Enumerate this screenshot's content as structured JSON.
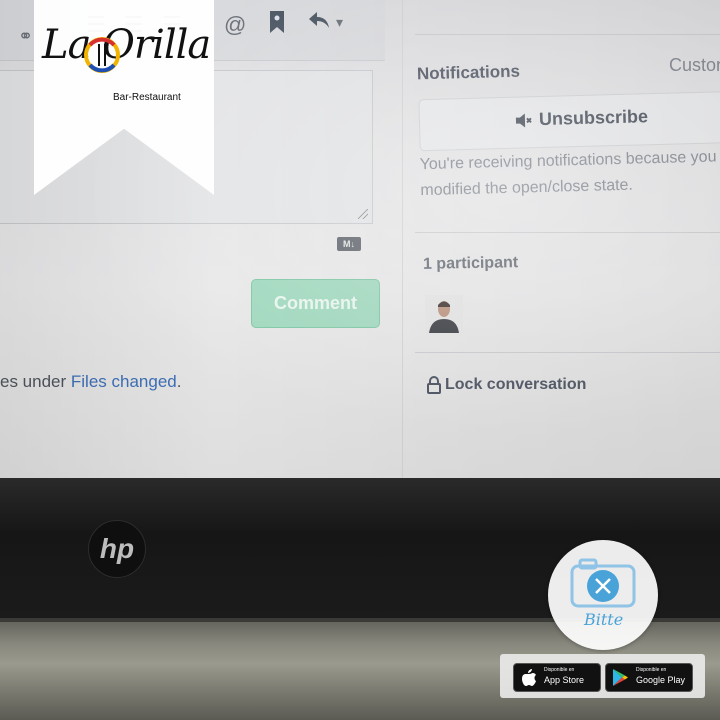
{
  "brand": {
    "name": "La Orilla",
    "subtitle": "Bar-Restaurant",
    "colors": {
      "banner": "#ffffff",
      "accent_blue": "#1f4fb0",
      "accent_yellow": "#f2b400",
      "accent_red": "#d6312c"
    }
  },
  "editor": {
    "markdown_badge": "M↓",
    "comment_button": "Comment",
    "footer_prefix": "es under ",
    "footer_link": "Files changed",
    "footer_suffix": "."
  },
  "toolbar": {
    "icons": [
      "link-icon",
      "unordered-list-icon",
      "ordered-list-icon",
      "task-list-icon",
      "mention-icon",
      "bookmark-icon",
      "reply-icon",
      "chevron-down-icon"
    ],
    "mention_glyph": "@",
    "dropdown_glyph": "▾"
  },
  "sidebar": {
    "notifications_label": "Notifications",
    "customize_label": "Custon",
    "unsubscribe_label": "Unsubscribe",
    "notification_reason": "You're receiving notifications because you modified the open/close state.",
    "participants_label": "1 participant",
    "lock_label": "Lock conversation"
  },
  "device": {
    "brand_logo": "hp"
  },
  "app_badge": {
    "name": "Bitte",
    "stores": [
      {
        "small": "Disponible en",
        "big": "App Store",
        "icon": "apple-icon"
      },
      {
        "small": "Disponible en",
        "big": "Google Play",
        "icon": "play-icon"
      }
    ]
  }
}
